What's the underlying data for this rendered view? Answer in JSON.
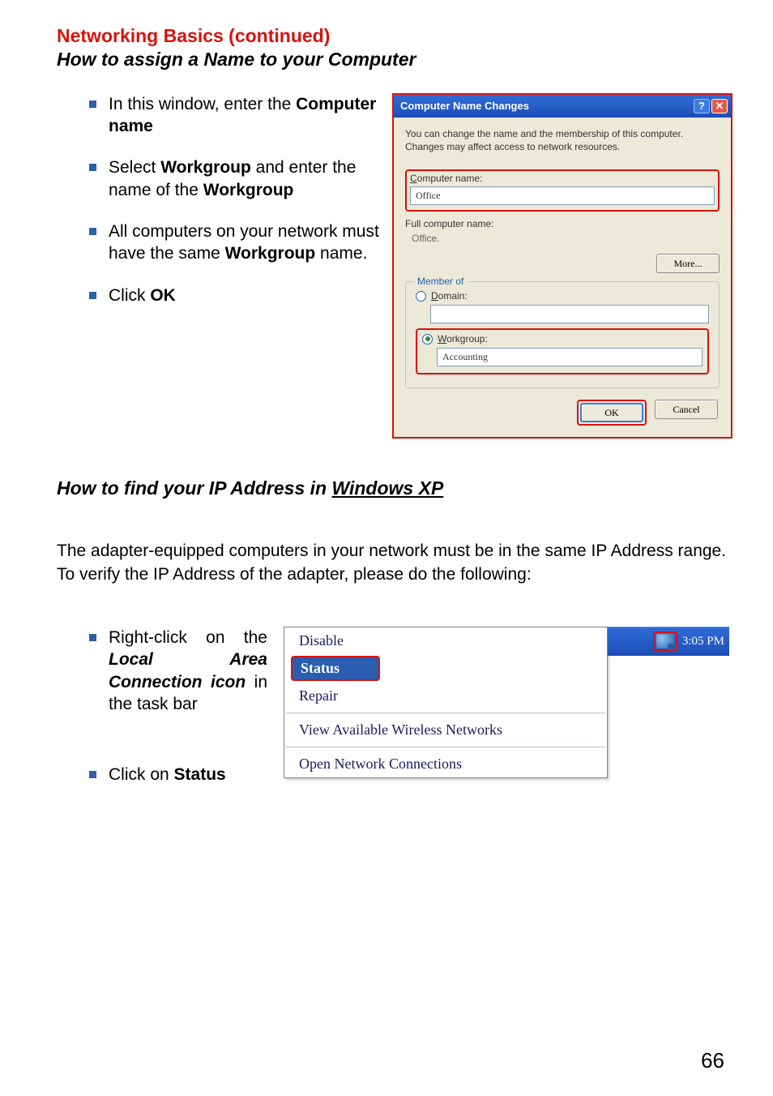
{
  "heading": {
    "red": "Networking Basics   (continued)",
    "sub": "How to assign a Name to your Computer"
  },
  "bullets_top": [
    {
      "pre": "In this window, enter the ",
      "bold": "Computer name"
    },
    {
      "pre": "Select ",
      "bold": "Workgroup",
      "post": " and enter the name of the ",
      "bold2": "Workgroup"
    },
    {
      "pre": "All computers on your network must have the same ",
      "bold": "Workgroup",
      "post": " name."
    },
    {
      "pre": "Click ",
      "bold": "OK"
    }
  ],
  "dialog": {
    "title": "Computer Name Changes",
    "desc": "You can change the name and the membership of this computer. Changes may affect access to network resources.",
    "computer_name_label": "Computer name:",
    "computer_name_value": "Office",
    "full_name_label": "Full computer name:",
    "full_name_value": "Office.",
    "more_btn": "More...",
    "member_of": "Member of",
    "domain_label": "Domain:",
    "workgroup_label": "Workgroup:",
    "workgroup_value": "Accounting",
    "ok": "OK",
    "cancel": "Cancel"
  },
  "section2": {
    "title_pre": "How to find your IP Address in ",
    "title_uline": "Windows XP",
    "para": "The adapter-equipped computers in your network must be in the same IP Address range. To verify the IP Address of the adapter, please do the following:"
  },
  "bullets_bottom": [
    {
      "pre": "Right-click on the ",
      "italic_bold": "Local Area Connection icon",
      "post": "  in the task bar"
    },
    {
      "pre": "Click on ",
      "bold": "Status"
    }
  ],
  "context_menu": {
    "disable": "Disable",
    "status": "Status",
    "repair": "Repair",
    "view_networks": "View Available Wireless Networks",
    "open_conn": "Open Network Connections"
  },
  "tray": {
    "time": "3:05 PM"
  },
  "page_number": "66"
}
